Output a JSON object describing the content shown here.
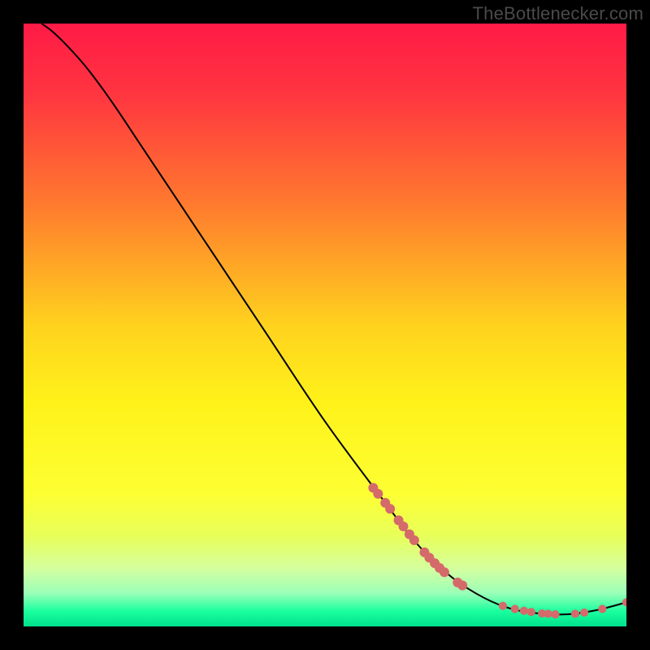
{
  "watermark": "TheBottlenecker.com",
  "chart_data": {
    "type": "line",
    "title": "",
    "xlabel": "",
    "ylabel": "",
    "xlim": [
      0,
      100
    ],
    "ylim": [
      0,
      100
    ],
    "background_gradient": {
      "stops": [
        {
          "pos": 0.0,
          "color": "#ff1a46"
        },
        {
          "pos": 0.12,
          "color": "#ff3640"
        },
        {
          "pos": 0.3,
          "color": "#ff7a2e"
        },
        {
          "pos": 0.5,
          "color": "#ffd21e"
        },
        {
          "pos": 0.63,
          "color": "#fff21a"
        },
        {
          "pos": 0.78,
          "color": "#fdff33"
        },
        {
          "pos": 0.85,
          "color": "#e8ff5a"
        },
        {
          "pos": 0.905,
          "color": "#d4ffa0"
        },
        {
          "pos": 0.945,
          "color": "#9affb8"
        },
        {
          "pos": 0.975,
          "color": "#1aff9e"
        },
        {
          "pos": 1.0,
          "color": "#00e28c"
        }
      ]
    },
    "curve": [
      {
        "x": 3.0,
        "y": 100.0
      },
      {
        "x": 5.0,
        "y": 98.5
      },
      {
        "x": 8.0,
        "y": 95.5
      },
      {
        "x": 11.0,
        "y": 92.0
      },
      {
        "x": 15.0,
        "y": 86.5
      },
      {
        "x": 20.0,
        "y": 79.0
      },
      {
        "x": 30.0,
        "y": 64.0
      },
      {
        "x": 40.0,
        "y": 49.0
      },
      {
        "x": 50.0,
        "y": 34.0
      },
      {
        "x": 60.0,
        "y": 20.5
      },
      {
        "x": 65.0,
        "y": 14.0
      },
      {
        "x": 70.0,
        "y": 9.0
      },
      {
        "x": 75.0,
        "y": 5.5
      },
      {
        "x": 80.0,
        "y": 3.2
      },
      {
        "x": 85.0,
        "y": 2.2
      },
      {
        "x": 90.0,
        "y": 2.0
      },
      {
        "x": 95.0,
        "y": 2.7
      },
      {
        "x": 100.0,
        "y": 4.0
      }
    ],
    "markers": {
      "color": "#d46a6a",
      "points": [
        {
          "x": 58.0,
          "y": 23.0,
          "r": 1.0
        },
        {
          "x": 58.8,
          "y": 22.0,
          "r": 1.0
        },
        {
          "x": 60.0,
          "y": 20.5,
          "r": 1.0
        },
        {
          "x": 60.8,
          "y": 19.5,
          "r": 1.0
        },
        {
          "x": 62.2,
          "y": 17.6,
          "r": 1.0
        },
        {
          "x": 63.0,
          "y": 16.6,
          "r": 1.0
        },
        {
          "x": 64.0,
          "y": 15.3,
          "r": 1.0
        },
        {
          "x": 64.8,
          "y": 14.3,
          "r": 1.0
        },
        {
          "x": 66.5,
          "y": 12.3,
          "r": 1.0
        },
        {
          "x": 67.3,
          "y": 11.4,
          "r": 1.0
        },
        {
          "x": 68.2,
          "y": 10.5,
          "r": 1.0
        },
        {
          "x": 69.0,
          "y": 9.7,
          "r": 1.0
        },
        {
          "x": 69.8,
          "y": 9.0,
          "r": 1.0
        },
        {
          "x": 72.0,
          "y": 7.3,
          "r": 1.0
        },
        {
          "x": 72.8,
          "y": 6.8,
          "r": 1.0
        },
        {
          "x": 79.5,
          "y": 3.4,
          "r": 0.85
        },
        {
          "x": 81.5,
          "y": 2.9,
          "r": 0.85
        },
        {
          "x": 83.0,
          "y": 2.6,
          "r": 0.85
        },
        {
          "x": 84.2,
          "y": 2.4,
          "r": 0.85
        },
        {
          "x": 86.0,
          "y": 2.15,
          "r": 0.85
        },
        {
          "x": 87.0,
          "y": 2.1,
          "r": 0.85
        },
        {
          "x": 88.2,
          "y": 2.0,
          "r": 0.85
        },
        {
          "x": 91.5,
          "y": 2.1,
          "r": 0.85
        },
        {
          "x": 93.0,
          "y": 2.3,
          "r": 0.85
        },
        {
          "x": 96.0,
          "y": 2.9,
          "r": 0.85
        },
        {
          "x": 100.0,
          "y": 4.0,
          "r": 0.85
        }
      ]
    }
  }
}
